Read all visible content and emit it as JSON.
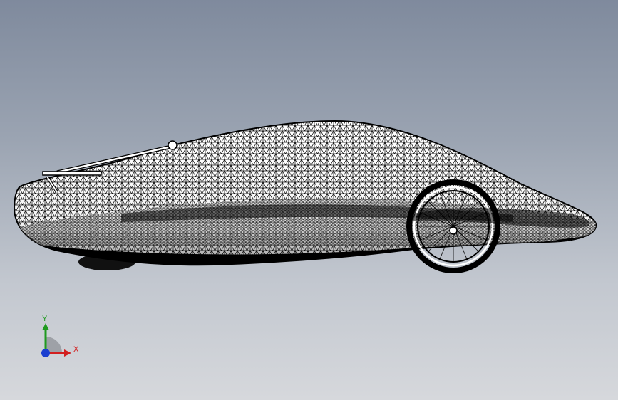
{
  "triad": {
    "x_label": "X",
    "y_label": "Y",
    "x_color": "#d21f1f",
    "y_color": "#1f9a1f",
    "z_color": "#1a3fd0"
  },
  "model": {
    "display_mode": "wireframe-mesh",
    "view": "side"
  },
  "colors": {
    "background_top": "#7f8a9d",
    "background_bottom": "#d6d8dc",
    "mesh_line": "#000000",
    "mesh_fill": "#ffffff"
  }
}
